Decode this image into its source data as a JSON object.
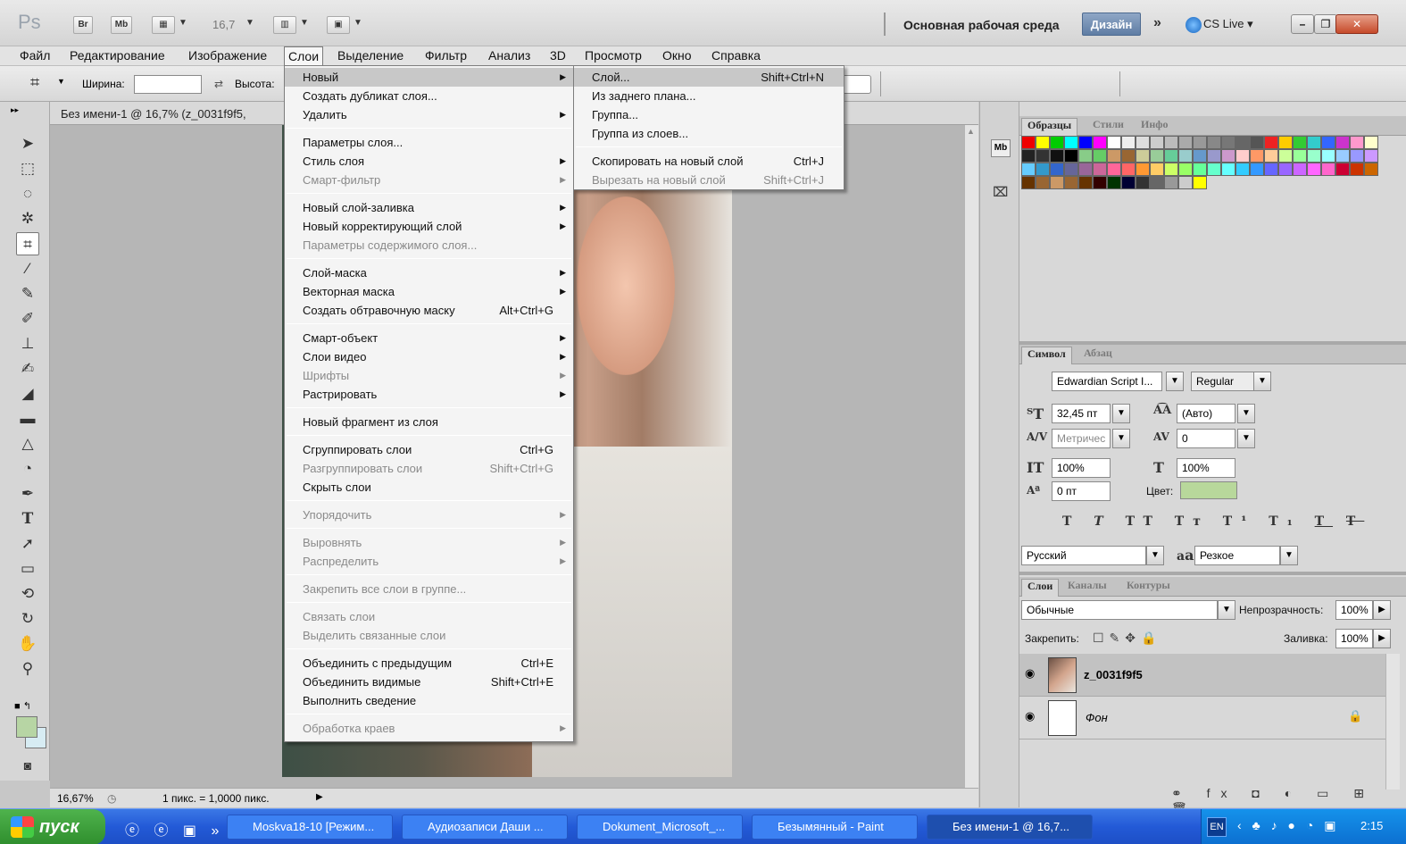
{
  "app": {
    "logo": "Ps",
    "br": "Br",
    "mb": "Mb",
    "zoom": "16,7",
    "workspace": "Основная рабочая среда",
    "design": "Дизайн",
    "more": "»",
    "cslive": "CS Live"
  },
  "menubar": [
    "Файл",
    "Редактирование",
    "Изображение",
    "Слои",
    "Выделение",
    "Фильтр",
    "Анализ",
    "3D",
    "Просмотр",
    "Окно",
    "Справка"
  ],
  "options": {
    "width_label": "Ширина:",
    "height_label": "Высота:"
  },
  "document": {
    "title": "Без имени-1 @ 16,7% (z_0031f9f5, ",
    "zoom": "16,67%",
    "scale": "1 пикс. = 1,0000 пикс."
  },
  "layers_menu": {
    "items": [
      {
        "label": "Новый",
        "arrow": true,
        "hl": true
      },
      {
        "label": "Создать дубликат слоя..."
      },
      {
        "label": "Удалить",
        "arrow": true
      },
      {
        "label": "Параметры слоя..."
      },
      {
        "label": "Стиль слоя",
        "arrow": true
      },
      {
        "label": "Смарт-фильтр",
        "arrow": true,
        "dis": true
      },
      {
        "label": "Новый слой-заливка",
        "arrow": true
      },
      {
        "label": "Новый корректирующий слой",
        "arrow": true
      },
      {
        "label": "Параметры содержимого слоя...",
        "dis": true
      },
      {
        "label": "Слой-маска",
        "arrow": true
      },
      {
        "label": "Векторная маска",
        "arrow": true
      },
      {
        "label": "Создать обтравочную маску",
        "sc": "Alt+Ctrl+G"
      },
      {
        "label": "Смарт-объект",
        "arrow": true
      },
      {
        "label": "Слои видео",
        "arrow": true
      },
      {
        "label": "Шрифты",
        "arrow": true,
        "dis": true
      },
      {
        "label": "Растрировать",
        "arrow": true
      },
      {
        "label": "Новый фрагмент из слоя"
      },
      {
        "label": "Сгруппировать слои",
        "sc": "Ctrl+G"
      },
      {
        "label": "Разгруппировать слои",
        "sc": "Shift+Ctrl+G",
        "dis": true
      },
      {
        "label": "Скрыть слои"
      },
      {
        "label": "Упорядочить",
        "arrow": true,
        "dis": true
      },
      {
        "label": "Выровнять",
        "arrow": true,
        "dis": true
      },
      {
        "label": "Распределить",
        "arrow": true,
        "dis": true
      },
      {
        "label": "Закрепить все слои в группе...",
        "dis": true
      },
      {
        "label": "Связать слои",
        "dis": true
      },
      {
        "label": "Выделить связанные слои",
        "dis": true
      },
      {
        "label": "Объединить с предыдущим",
        "sc": "Ctrl+E"
      },
      {
        "label": "Объединить видимые",
        "sc": "Shift+Ctrl+E"
      },
      {
        "label": "Выполнить сведение"
      },
      {
        "label": "Обработка краев",
        "arrow": true,
        "dis": true
      }
    ]
  },
  "new_submenu": [
    {
      "label": "Слой...",
      "sc": "Shift+Ctrl+N",
      "hl": true
    },
    {
      "label": "Из заднего плана..."
    },
    {
      "label": "Группа..."
    },
    {
      "label": "Группа из слоев..."
    },
    {
      "label": "Скопировать на новый слой",
      "sc": "Ctrl+J"
    },
    {
      "label": "Вырезать на новый слой",
      "sc": "Shift+Ctrl+J",
      "dis": true
    }
  ],
  "swatches_panel": {
    "tabs": [
      "Образцы",
      "Стили",
      "Инфо"
    ]
  },
  "character_panel": {
    "tabs": [
      "Символ",
      "Абзац"
    ],
    "font": "Edwardian Script I...",
    "style": "Regular",
    "size": "32,45 пт",
    "leading": "(Авто)",
    "kerning": "Метричес",
    "tracking": "0",
    "vscale": "100%",
    "hscale": "100%",
    "baseline": "0 пт",
    "color_label": "Цвет:",
    "language": "Русский",
    "aa": "Резкое",
    "aa_label": "a",
    "aa_sym": "a"
  },
  "layers_panel": {
    "tabs": [
      "Слои",
      "Каналы",
      "Контуры"
    ],
    "blend": "Обычные",
    "opacity_label": "Непрозрачность:",
    "opacity": "100%",
    "lock_label": "Закрепить:",
    "fill_label": "Заливка:",
    "fill": "100%",
    "layers": [
      {
        "name": "z_0031f9f5"
      },
      {
        "name": "Фон"
      }
    ]
  },
  "taskbar": {
    "start": "пуск",
    "tasks": [
      "Moskva18-10 [Режим...",
      "Аудиозаписи Даши ...",
      "Dokument_Microsoft_...",
      "Безымянный - Paint",
      "Без имени-1 @ 16,7..."
    ],
    "lang": "EN",
    "clock": "2:15"
  },
  "colors": {
    "fg": "#b7d5a4",
    "bg": "#d7ecf3",
    "text_color": "#b8d89b"
  }
}
